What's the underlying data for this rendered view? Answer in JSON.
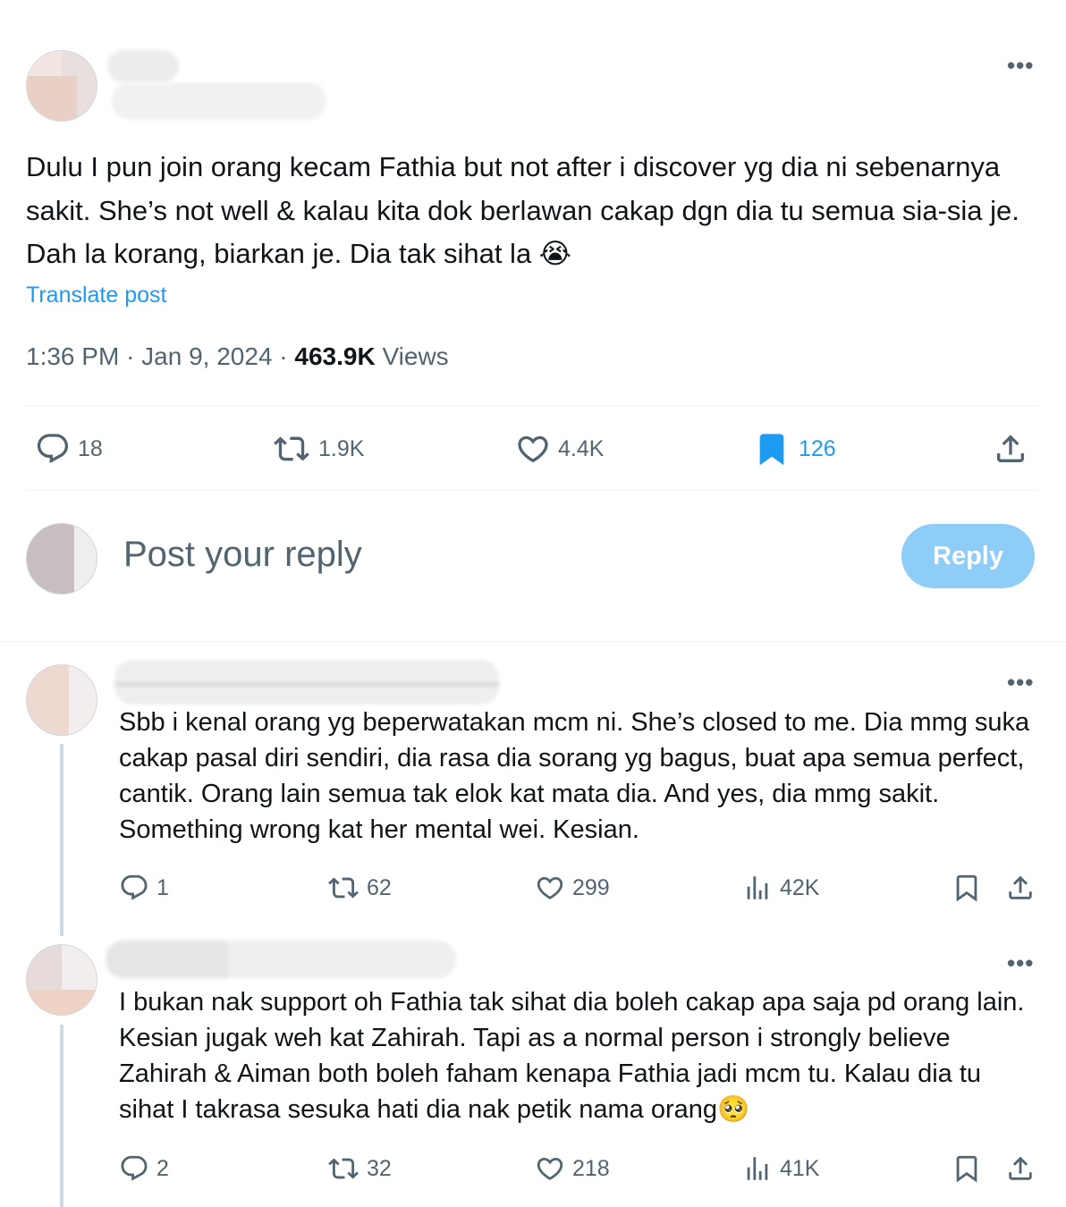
{
  "main_post": {
    "text": "Dulu I pun join orang kecam Fathia but not after i discover yg dia ni sebenarnya sakit. She’s not well & kalau kita dok berlawan cakap dgn dia tu semua sia-sia je. Dah la korang, biarkan je. Dia tak sihat la 😭",
    "translate_label": "Translate post",
    "time": "1:36 PM",
    "date": "Jan 9, 2024",
    "views_count": "463.9K",
    "views_label": "Views",
    "stats": {
      "replies": "18",
      "reposts": "1.9K",
      "likes": "4.4K",
      "bookmarks": "126"
    }
  },
  "composer": {
    "placeholder": "Post your reply",
    "reply_button": "Reply"
  },
  "replies": [
    {
      "text": "Sbb i kenal orang yg beperwatakan mcm ni.  She’s closed to me. Dia mmg suka cakap pasal diri sendiri, dia rasa dia sorang yg bagus, buat apa semua perfect, cantik. Orang lain semua tak elok kat mata dia. And yes, dia mmg sakit. Something wrong kat her mental wei. Kesian.",
      "replies": "1",
      "reposts": "62",
      "likes": "299",
      "views": "42K"
    },
    {
      "text": "I bukan nak support oh Fathia tak sihat dia boleh cakap apa saja pd orang lain. Kesian jugak weh kat Zahirah. Tapi as a normal person i strongly believe Zahirah & Aiman both boleh faham kenapa Fathia jadi mcm tu. Kalau dia tu sihat I takrasa sesuka hati dia nak petik nama orang🥺",
      "replies": "2",
      "reposts": "32",
      "likes": "218",
      "views": "41K"
    }
  ],
  "colors": {
    "accent": "#1d9bf0",
    "secondary_text": "#536471",
    "reply_button_disabled": "#8ecdf8"
  },
  "icons": [
    "more-icon",
    "reply-icon",
    "repost-icon",
    "like-icon",
    "bookmark-icon",
    "share-icon",
    "views-icon"
  ]
}
